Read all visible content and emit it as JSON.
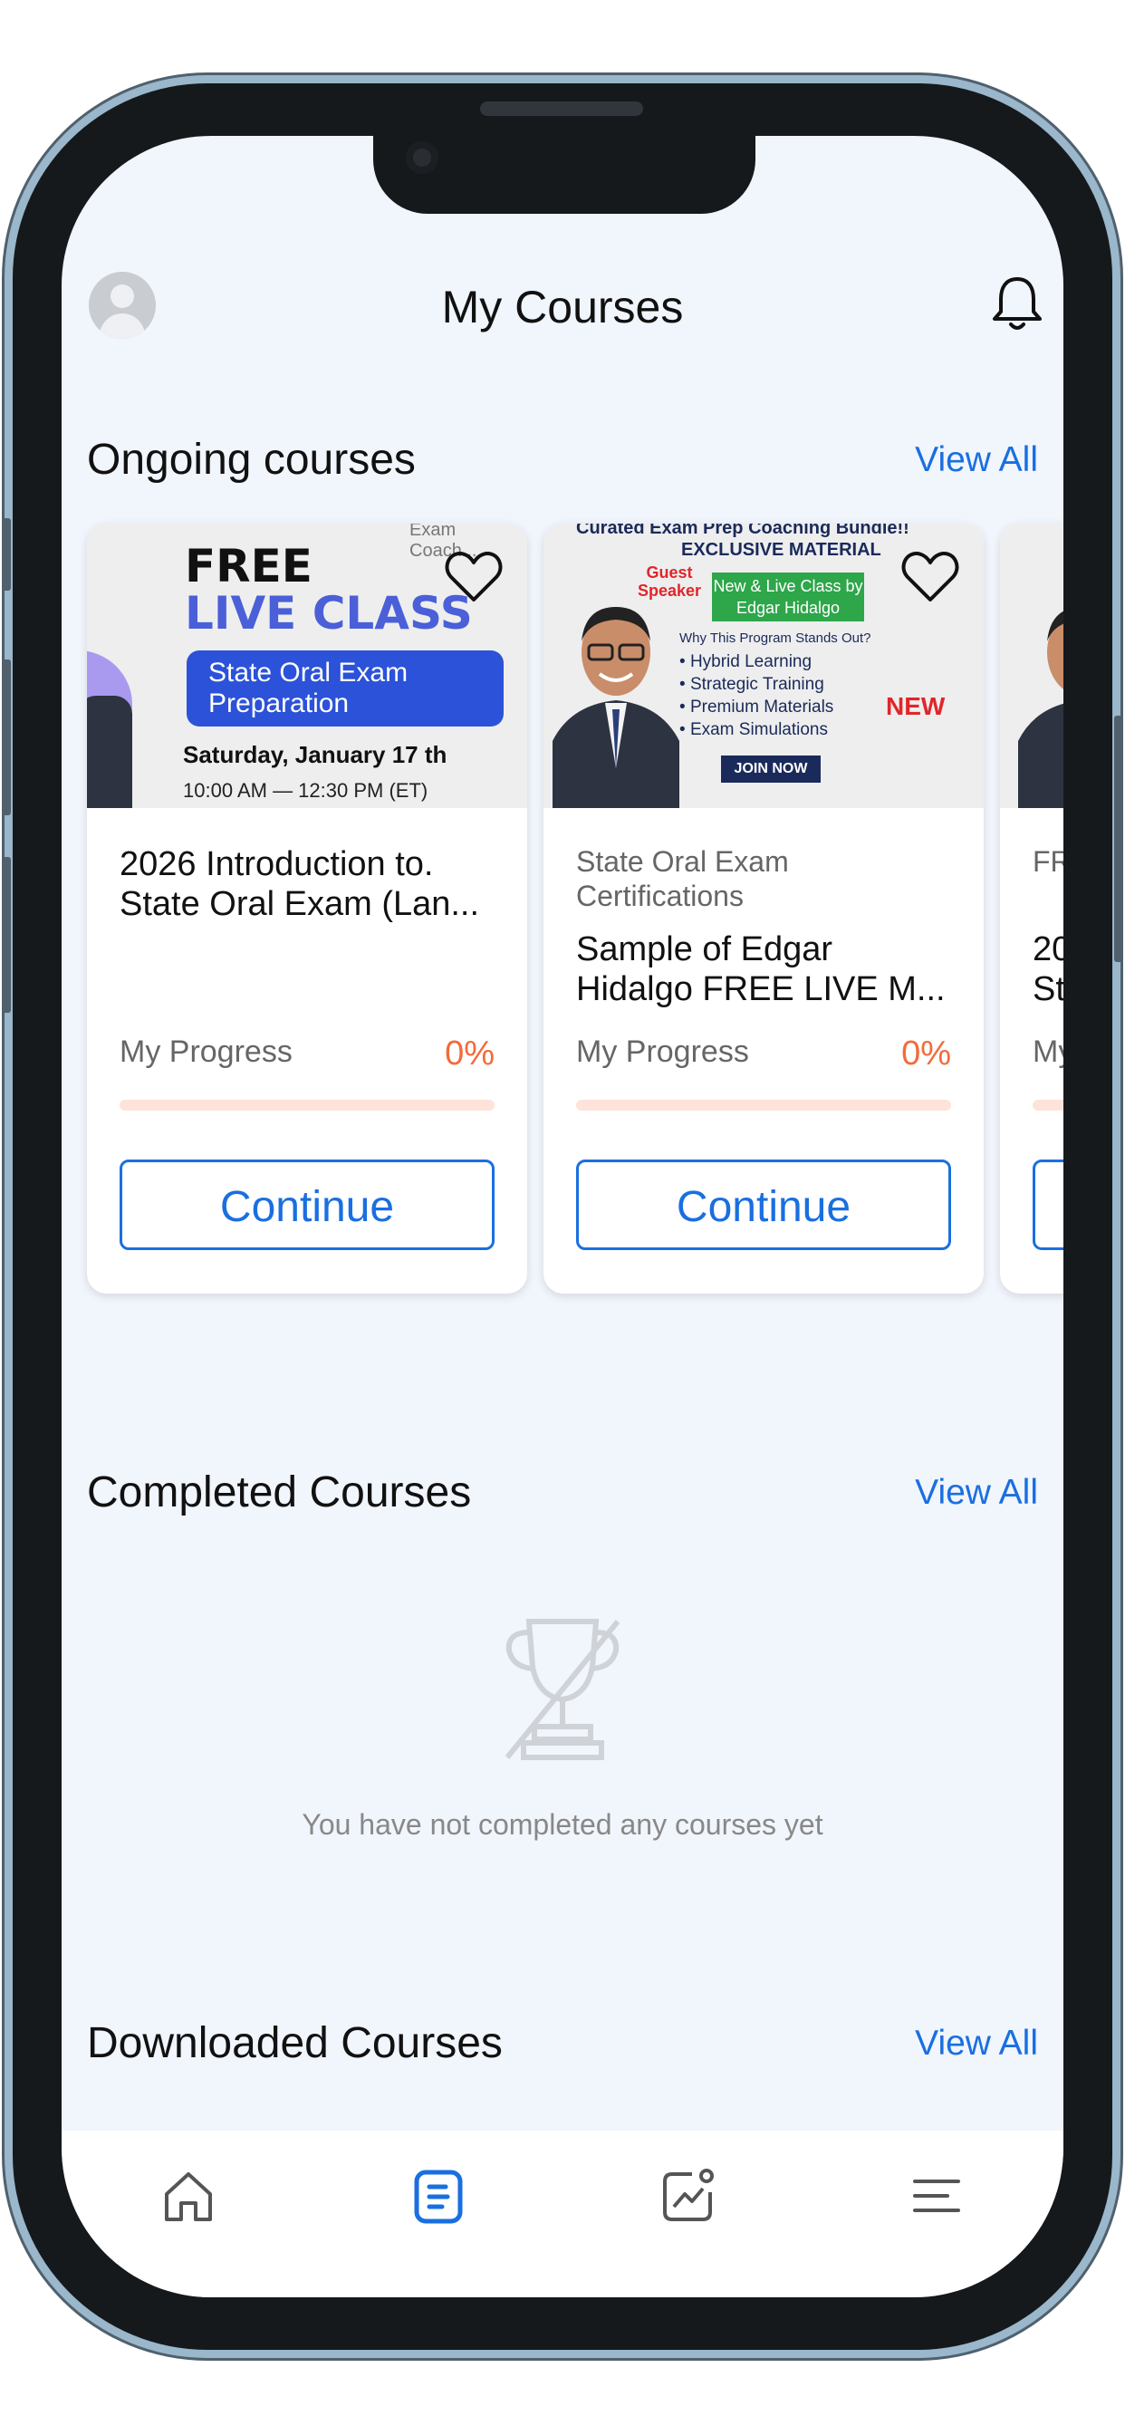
{
  "header": {
    "title": "My Courses"
  },
  "ongoing": {
    "title": "Ongoing courses",
    "view_all": "View All",
    "courses": [
      {
        "category": "",
        "title": "2026 Introduction to. State Oral Exam (Lan...",
        "progress_label": "My Progress",
        "progress": "0%",
        "progress_fraction": 0,
        "button": "Continue",
        "thumb": {
          "top": "Exam Coach...",
          "free": "FREE",
          "live": "LIVE CLASS",
          "box": "State Oral Exam Preparation",
          "date": "Saturday, January 17 th",
          "time": "10:00 AM — 12:30 PM (ET)"
        }
      },
      {
        "category": "State Oral Exam Certifications",
        "title": "Sample of Edgar Hidalgo FREE LIVE M...",
        "progress_label": "My Progress",
        "progress": "0%",
        "progress_fraction": 0,
        "button": "Continue",
        "thumb": {
          "top": "Curated Exam Prep Coaching Bundle!!",
          "exclusive": "EXCLUSIVE MATERIAL",
          "guest": "Guest Speaker",
          "green": "New & Live Class by Edgar Hidalgo",
          "why": "Why This Program Stands Out?",
          "list": [
            "Hybrid Learning",
            "Strategic Training",
            "Premium Materials",
            "Exam Simulations"
          ],
          "new": "NEW",
          "join": "JOIN NOW"
        }
      },
      {
        "category": "FR",
        "title": "20 St",
        "progress_label": "My",
        "button": ""
      }
    ]
  },
  "completed": {
    "title": "Completed Courses",
    "view_all": "View All",
    "empty_text": "You have not completed any courses yet"
  },
  "downloaded": {
    "title": "Downloaded Courses",
    "view_all": "View All"
  },
  "nav": [
    "home-icon",
    "courses-icon",
    "progress-icon",
    "menu-icon"
  ],
  "colors": {
    "accent": "#1a6fe0",
    "progress": "#f26b3a",
    "background": "#f1f5fc"
  }
}
